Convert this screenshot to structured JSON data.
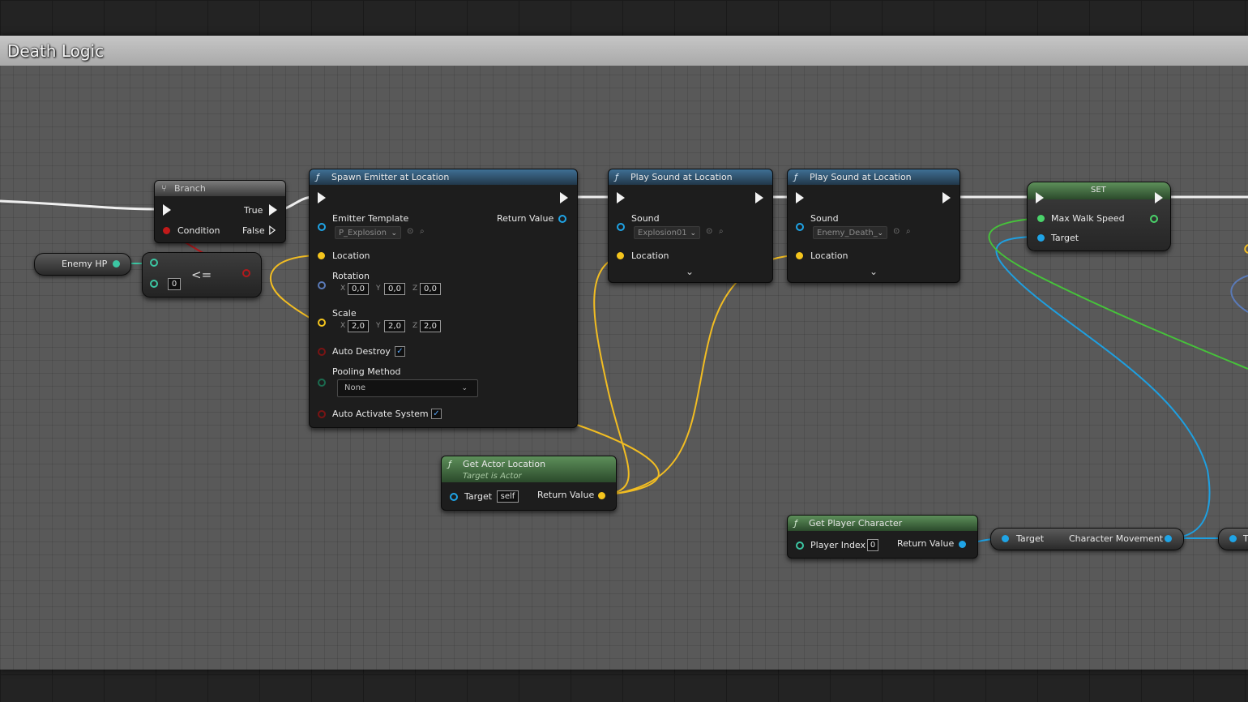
{
  "graph": {
    "comment_title": "Death Logic"
  },
  "colors": {
    "exec_wire": "#f0f0f0",
    "vector_pin": "#f5c51d",
    "object_pin": "#1fa4e6",
    "float_pin": "#4ad36a",
    "bool_pin": "#c21a1a",
    "int_pin": "#3cc6a3",
    "struct_pin": "#5a7ab8"
  },
  "branch": {
    "title": "Branch",
    "true_label": "True",
    "false_label": "False",
    "condition_label": "Condition"
  },
  "enemy_hp": {
    "label": "Enemy HP"
  },
  "compare": {
    "operator": "<=",
    "b_value": "0"
  },
  "spawn_emitter": {
    "title": "Spawn Emitter at Location",
    "emitter_template_label": "Emitter Template",
    "emitter_template_value": "P_Explosion",
    "return_value_label": "Return Value",
    "location_label": "Location",
    "rotation_label": "Rotation",
    "rotation": {
      "x": "0,0",
      "y": "0,0",
      "z": "0,0"
    },
    "scale_label": "Scale",
    "scale": {
      "x": "2,0",
      "y": "2,0",
      "z": "2,0"
    },
    "auto_destroy_label": "Auto Destroy",
    "auto_destroy_checked": true,
    "pooling_method_label": "Pooling Method",
    "pooling_method_value": "None",
    "auto_activate_label": "Auto Activate System",
    "auto_activate_checked": true,
    "axis_x": "X",
    "axis_y": "Y",
    "axis_z": "Z"
  },
  "play_sound_1": {
    "title": "Play Sound at Location",
    "sound_label": "Sound",
    "sound_value": "Explosion01",
    "location_label": "Location"
  },
  "play_sound_2": {
    "title": "Play Sound at Location",
    "sound_label": "Sound",
    "sound_value": "Enemy_Death_",
    "location_label": "Location"
  },
  "set_node": {
    "title": "SET",
    "max_walk_speed_label": "Max Walk Speed",
    "target_label": "Target"
  },
  "get_actor_location": {
    "title": "Get Actor Location",
    "subtitle": "Target is Actor",
    "target_label": "Target",
    "target_value": "self",
    "return_value_label": "Return Value"
  },
  "get_player_character": {
    "title": "Get Player Character",
    "player_index_label": "Player Index",
    "player_index_value": "0",
    "return_value_label": "Return Value"
  },
  "char_movement": {
    "target_label": "Target",
    "output_label": "Character Movement",
    "cut_label": "T"
  },
  "icons": [
    "function-icon",
    "branch-icon",
    "chevron-down-icon",
    "checkmark-icon",
    "browse-icon",
    "search-icon"
  ]
}
